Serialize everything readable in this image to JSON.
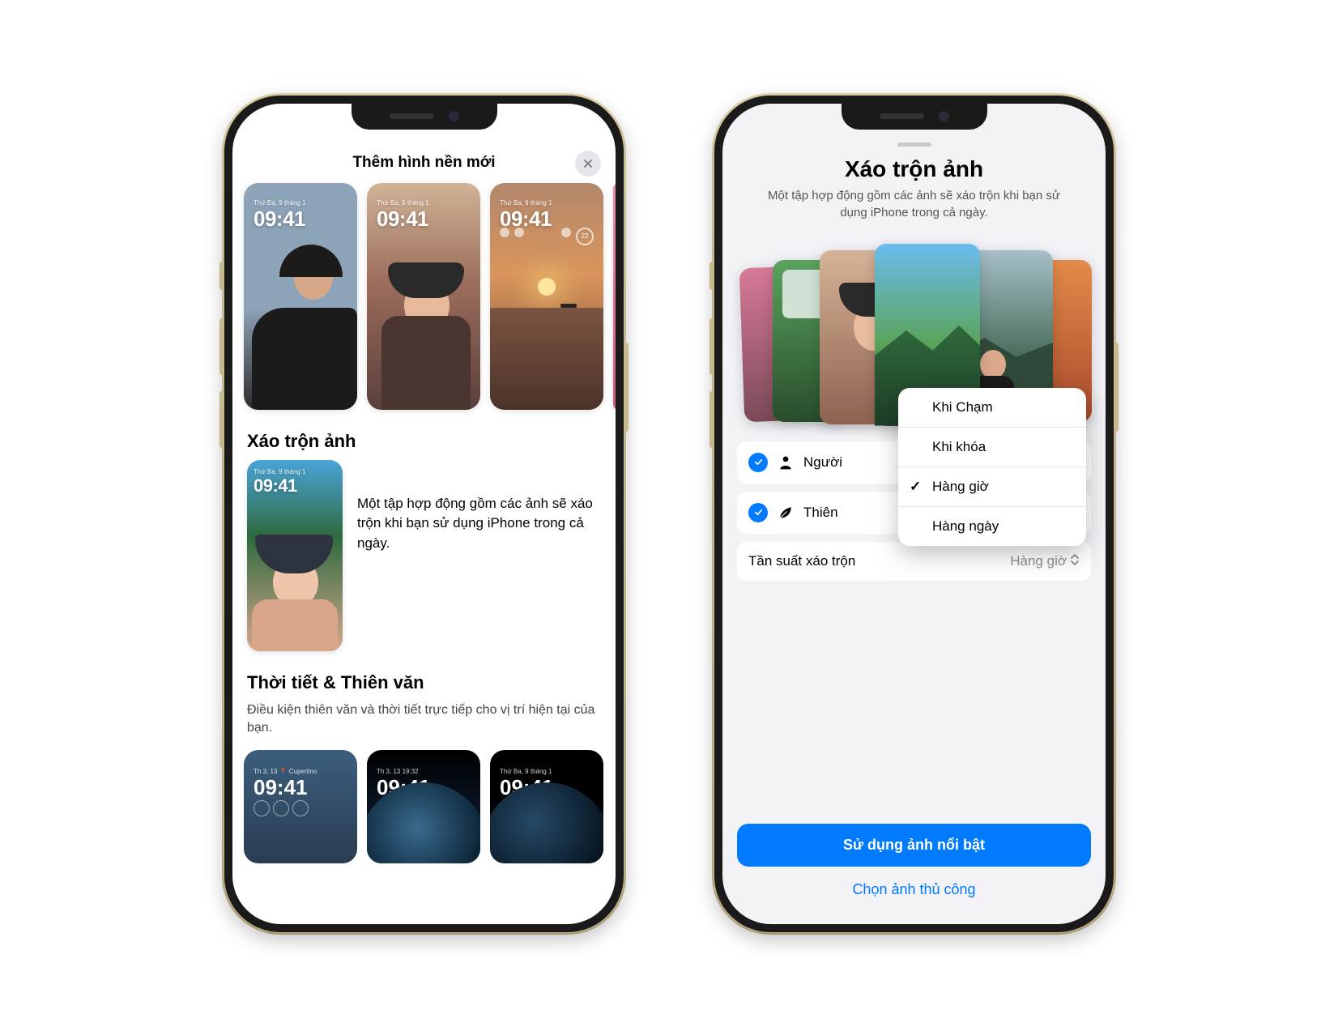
{
  "left": {
    "header": {
      "title": "Thêm hình nền mới"
    },
    "previews": [
      {
        "date": "Thứ Ba, 9 tháng 1",
        "time": "09:41"
      },
      {
        "date": "Thứ Ba, 9 tháng 1",
        "time": "09:41"
      },
      {
        "date": "Thứ Ba, 9 tháng 1",
        "time": "09:41",
        "widget_text": "22"
      }
    ],
    "shuffle": {
      "title": "Xáo trộn ảnh",
      "card": {
        "date": "Thứ Ba, 9 tháng 1",
        "time": "09:41"
      },
      "description": "Một tập hợp động gồm các ảnh sẽ xáo trộn khi bạn sử dụng iPhone trong cả ngày."
    },
    "weather": {
      "title": "Thời tiết & Thiên văn",
      "subtitle": "Điều kiện thiên văn và thời tiết trực tiếp cho vị trí hiện tại của bạn.",
      "cards": [
        {
          "date": "Th 3, 13 📍 Cupertino",
          "time": "09:41"
        },
        {
          "date": "Th 3, 13  19:32",
          "time": "09:41"
        },
        {
          "date": "Thứ Ba, 9 tháng 1",
          "time": "09:41"
        }
      ]
    }
  },
  "right": {
    "title": "Xáo trộn ảnh",
    "subtitle": "Một tập hợp động gồm các ảnh sẽ xáo trộn khi bạn sử dụng iPhone trong cả ngày.",
    "option_people": {
      "label": "Người"
    },
    "option_nature": {
      "label": "Thiên"
    },
    "frequency": {
      "label": "Tần suất xáo trộn",
      "value": "Hàng giờ"
    },
    "popup": {
      "items": [
        {
          "label": "Khi Chạm",
          "checked": false
        },
        {
          "label": "Khi khóa",
          "checked": false
        },
        {
          "label": "Hàng giờ",
          "checked": true
        },
        {
          "label": "Hàng ngày",
          "checked": false
        }
      ]
    },
    "primary_button": "Sử dụng ảnh nổi bật",
    "secondary_link": "Chọn ảnh thủ công"
  }
}
